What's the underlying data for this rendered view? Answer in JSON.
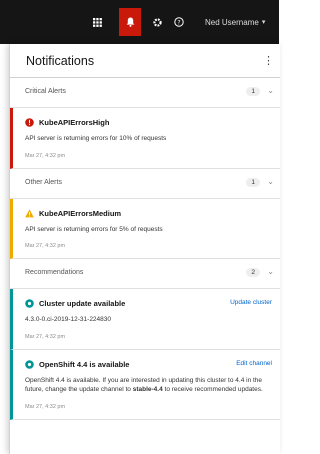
{
  "masthead": {
    "user_name": "Ned Username",
    "user_caret": "▾",
    "help_glyph": "?"
  },
  "drawer": {
    "title": "Notifications",
    "kebab_glyph": "⋮",
    "groups": [
      {
        "title": "Critical Alerts",
        "count": "1",
        "toggle": "⌄",
        "items": [
          {
            "title": "KubeAPIErrorsHigh",
            "description": "API server is returning errors for 10% of requests",
            "timestamp": "Mar 27, 4:32 pm"
          }
        ]
      },
      {
        "title": "Other Alerts",
        "count": "1",
        "toggle": "⌄",
        "items": [
          {
            "title": "KubeAPIErrorsMedium",
            "description": "API server is returning errors for 5% of requests",
            "timestamp": "Mar 27, 4:32 pm"
          }
        ]
      },
      {
        "title": "Recommendations",
        "count": "2",
        "toggle": "⌄",
        "items": [
          {
            "title": "Cluster update available",
            "action": "Update cluster",
            "description": "4.3.0-0.ci-2019-12-31-224830",
            "timestamp": "Mar 27, 4:32 pm"
          },
          {
            "title": "OpenShift 4.4 is available",
            "action": "Edit channel",
            "description_a": "OpenShift 4.4 is available. If you are interested in updating this cluster to 4.4 in the future, change the update channel to ",
            "description_strong": "stable-4.4",
            "description_b": " to receive recommended updates.",
            "timestamp": "Mar 27, 4:32 pm"
          }
        ]
      }
    ]
  },
  "colors": {
    "danger": "#c9190b",
    "warning": "#f0ab00",
    "info": "#009596",
    "link": "#0066cc"
  },
  "icons": {
    "apps": "grid-icon",
    "notifications": "bell-icon",
    "settings": "gear-icon",
    "help": "help-icon"
  }
}
